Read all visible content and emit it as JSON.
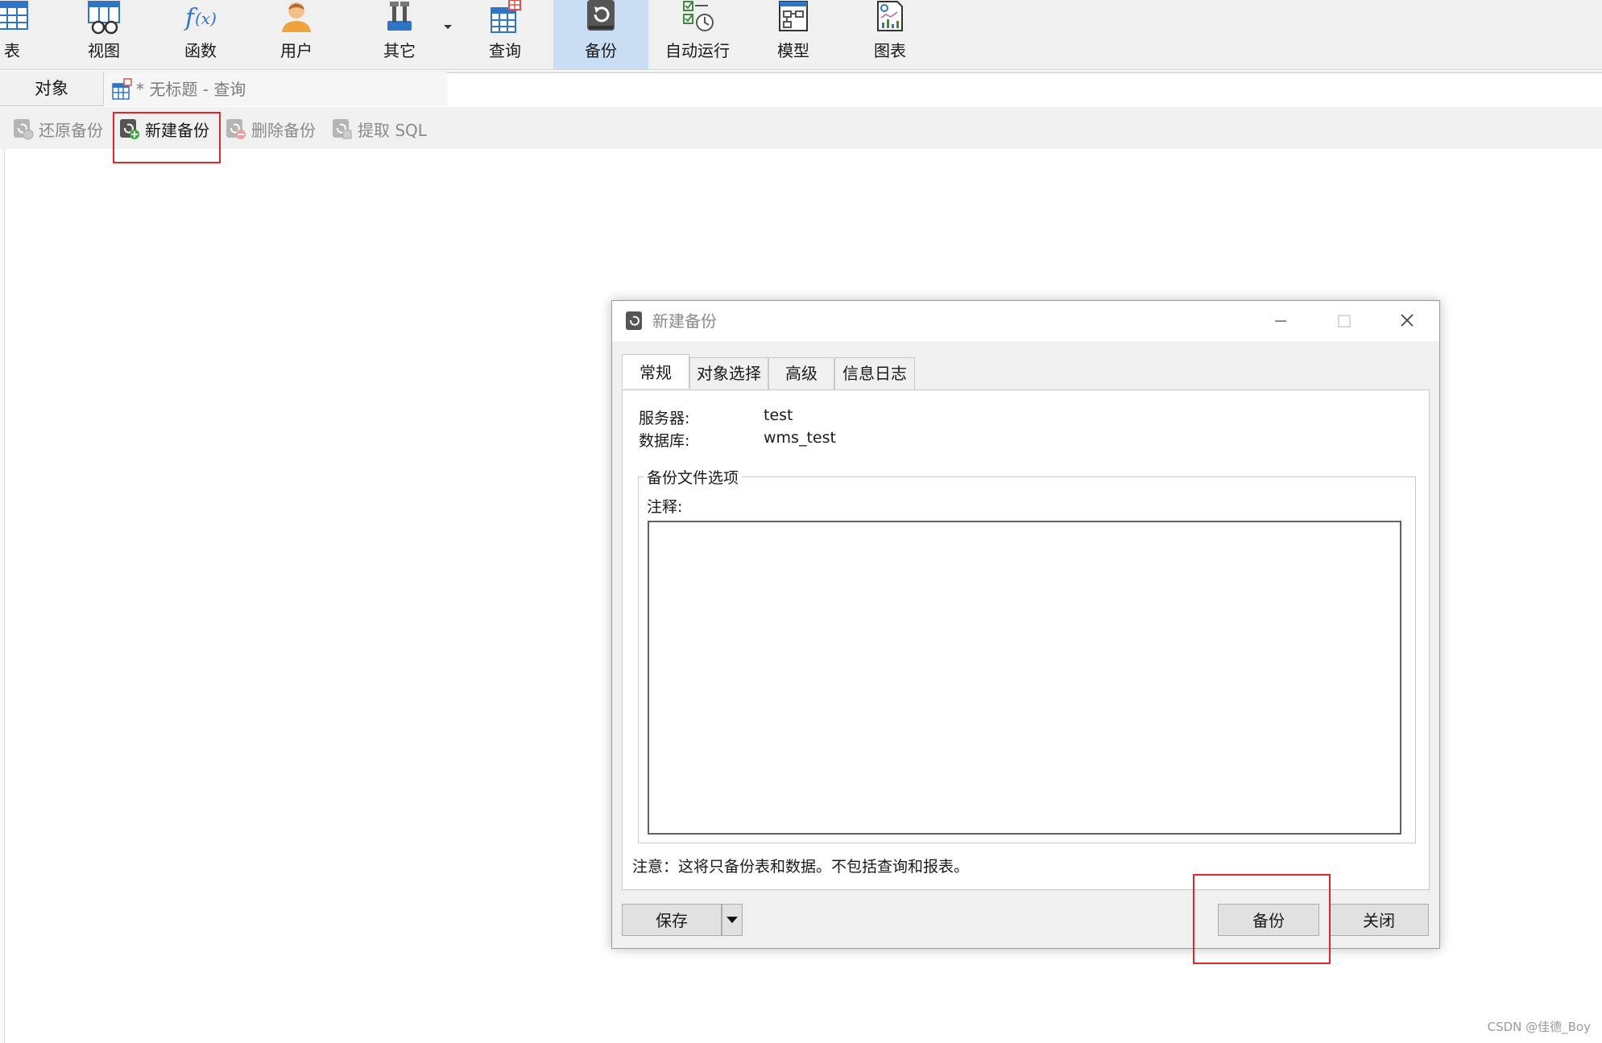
{
  "ribbon": {
    "items": [
      {
        "label": "表",
        "icon": "table-icon"
      },
      {
        "label": "视图",
        "icon": "view-icon"
      },
      {
        "label": "函数",
        "icon": "function-icon"
      },
      {
        "label": "用户",
        "icon": "user-icon"
      },
      {
        "label": "其它",
        "icon": "tools-icon"
      },
      {
        "label": "查询",
        "icon": "query-icon"
      },
      {
        "label": "备份",
        "icon": "backup-icon"
      },
      {
        "label": "自动运行",
        "icon": "automation-icon"
      },
      {
        "label": "模型",
        "icon": "model-icon"
      },
      {
        "label": "图表",
        "icon": "chart-icon"
      }
    ],
    "active": "备份"
  },
  "tabs": {
    "objects": "对象",
    "query_tab": "* 无标题 - 查询"
  },
  "subtoolbar": {
    "restore": "还原备份",
    "new_backup": "新建备份",
    "delete_backup": "删除备份",
    "extract_sql": "提取 SQL"
  },
  "dialog": {
    "title": "新建备份",
    "tabs": [
      "常规",
      "对象选择",
      "高级",
      "信息日志"
    ],
    "server_label": "服务器:",
    "server_value": "test",
    "database_label": "数据库:",
    "database_value": "wms_test",
    "group_title": "备份文件选项",
    "comment_label": "注释:",
    "comment_value": "",
    "note": "注意：这将只备份表和数据。不包括查询和报表。",
    "save_button": "保存",
    "backup_button": "备份",
    "close_button": "关闭"
  },
  "watermark": "CSDN @佳德_Boy",
  "colors": {
    "accent": "#c9def3",
    "highlight_box": "#e0252b"
  }
}
